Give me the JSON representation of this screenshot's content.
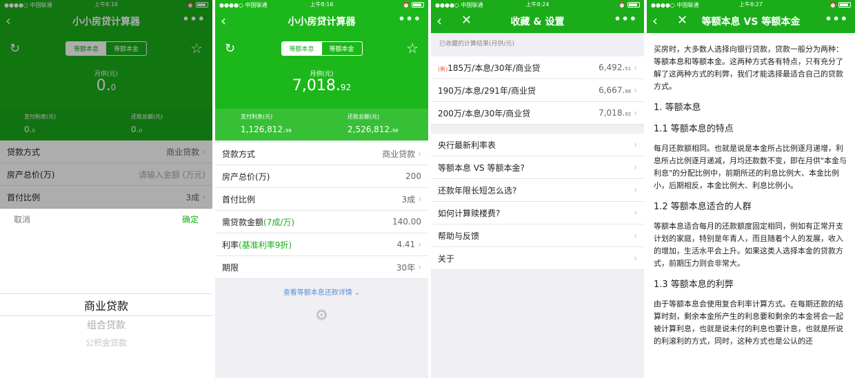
{
  "status": {
    "carrier": "●●●●○ 中国联通",
    "s1_time": "上午8:16",
    "s2_time": "上午8:16",
    "s3_time": "上午8:24",
    "s4_time": "上午8:27"
  },
  "calc": {
    "title": "小小房贷计算器",
    "tab_equal_interest": "等额本息",
    "tab_equal_principal": "等额本金",
    "monthly_label": "月供(元)",
    "interest_label": "支付利息(元)",
    "total_label": "还款总额(元)",
    "s1_monthly_int": "0.",
    "s1_monthly_dec": "0",
    "s1_interest_int": "0.",
    "s1_interest_dec": "0",
    "s1_total_int": "0.",
    "s1_total_dec": "0",
    "s2_monthly_int": "7,018.",
    "s2_monthly_dec": "92",
    "s2_interest_int": "1,126,812.",
    "s2_interest_dec": "98",
    "s2_total_int": "2,526,812.",
    "s2_total_dec": "98",
    "loan_type_label": "贷款方式",
    "loan_type_value": "商业贷款",
    "price_label": "房产总价",
    "price_unit": "(万)",
    "price_placeholder": "请输入金额 (万元)",
    "price_value": "200",
    "down_label": "首付比例",
    "down_value": "3成",
    "loan_amount_label": "需贷款金额",
    "loan_amount_hint": "(7成/万)",
    "loan_amount_value": "140.00",
    "rate_label": "利率",
    "rate_hint": "(基准利率9折)",
    "rate_value": "4.41",
    "term_label": "期限",
    "term_value": "30年",
    "detail_link": "查看等额本息还款详情"
  },
  "picker": {
    "cancel": "取消",
    "confirm": "确定",
    "options": [
      "商业贷款",
      "组合贷款",
      "公积金贷款"
    ]
  },
  "settings": {
    "title": "收藏 & 设置",
    "saved_header": "已收藏的计算结果(月供/元)",
    "new_badge": "(新)",
    "saved": [
      {
        "label": "185万/本息/30年/商业贷",
        "int": "6,492.",
        "dec": "51"
      },
      {
        "label": "190万/本息/291年/商业贷",
        "int": "6,667.",
        "dec": "98"
      },
      {
        "label": "200万/本息/30年/商业贷",
        "int": "7,018.",
        "dec": "92"
      }
    ],
    "menu": [
      "央行最新利率表",
      "等额本息 VS 等额本金?",
      "还款年限长短怎么选?",
      "如何计算赎楼费?",
      "帮助与反馈",
      "关于"
    ]
  },
  "article": {
    "title": "等额本息 VS 等额本金",
    "intro": "买房时，大多数人选择向银行贷款，贷款一般分为两种：等额本息和等额本金。这两种方式各有特点，只有充分了解了这两种方式的利弊，我们才能选择最适合自己的贷款方式。",
    "h1": "1. 等额本息",
    "h11": "1.1 等额本息的特点",
    "p11": "每月还款额相同。也就是说是本金所占比例逐月递增，利息所占比例逐月递减，月均还款数不变，即在月供\"本金与利息\"的分配比例中，前期所还的利息比例大、本金比例小，后期相反，本金比例大、利息比例小。",
    "h12": "1.2 等额本息适合的人群",
    "p12": "等额本息适合每月的还款额度固定相同，例如有正常开支计划的家庭，特别是年青人，而且随着个人的发展，收入的增加，生活水平会上升。如果这类人选择本金的贷款方式，前期压力则会非常大。",
    "h13": "1.3 等额本息的利弊",
    "p13": "由于等额本息会使用复合利率计算方式。在每期还款的结算时刻，剩余本金所产生的利息要和剩余的本金将会一起被计算利息，也就是说未付的利息也要计息，也就是所说的利滚利的方式，同时，这种方式也是公认的还"
  },
  "colors": {
    "accent": "#1aad19"
  }
}
